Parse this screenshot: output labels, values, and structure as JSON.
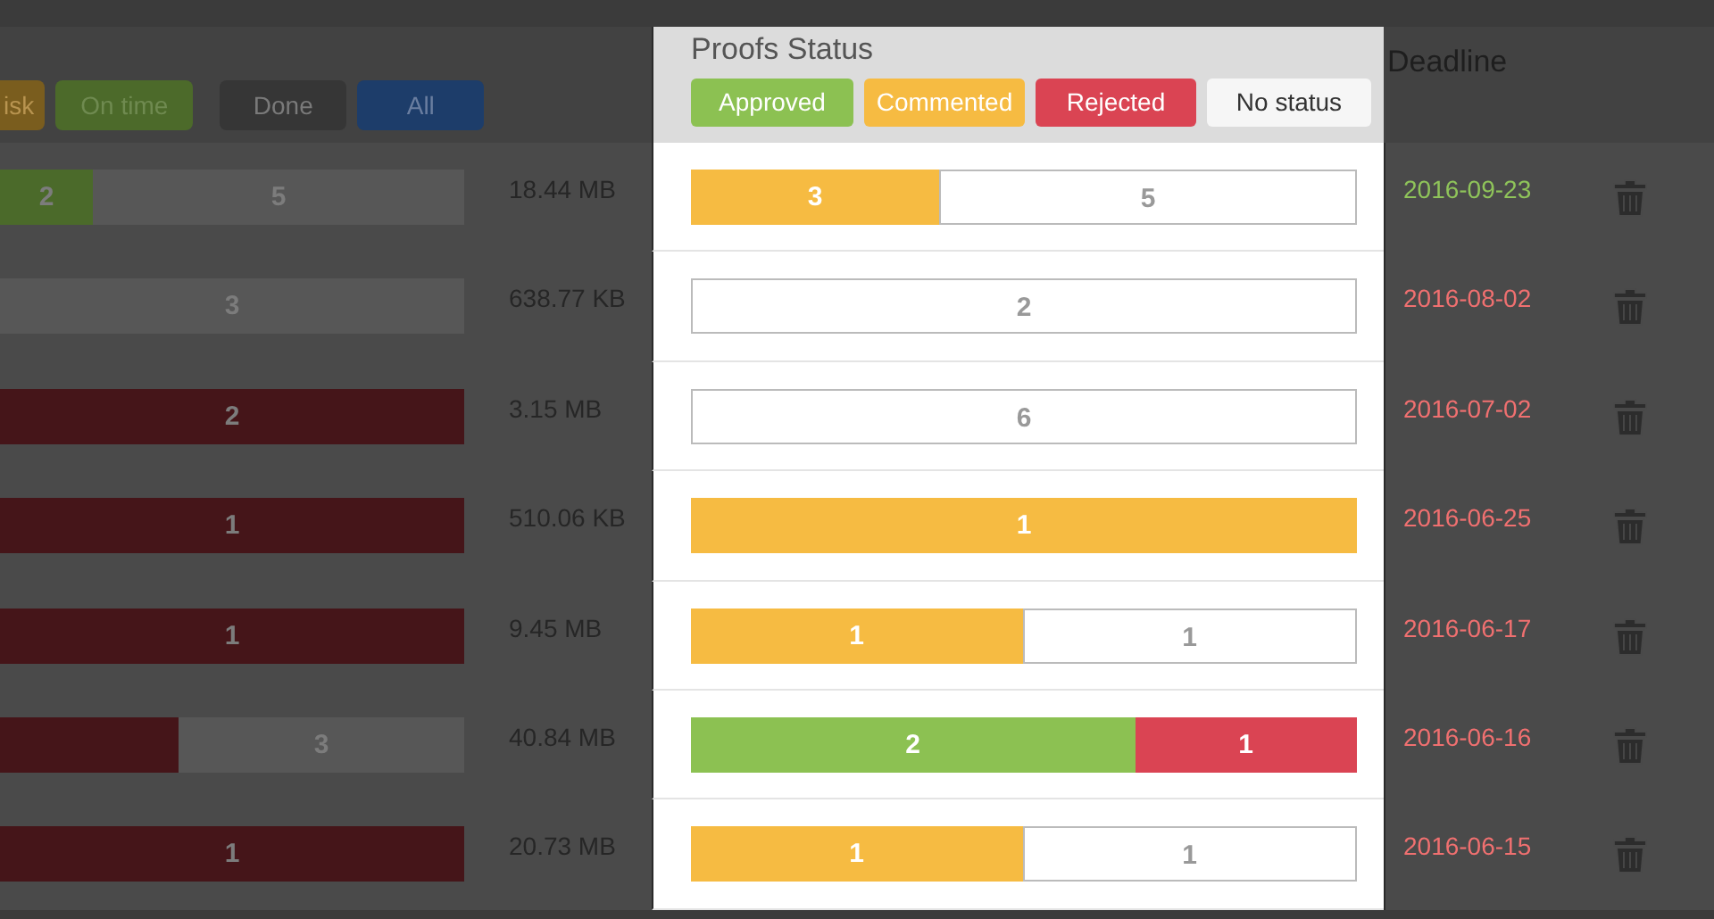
{
  "filters": [
    {
      "label": "isk",
      "kind": "at-risk"
    },
    {
      "label": "On time",
      "kind": "on-time"
    },
    {
      "label": "Done",
      "kind": "done"
    },
    {
      "label": "All",
      "kind": "all"
    }
  ],
  "deadline_header": "Deadline",
  "proofs_panel": {
    "title": "Proofs Status",
    "legend": [
      {
        "label": "Approved",
        "kind": "approved"
      },
      {
        "label": "Commented",
        "kind": "commented"
      },
      {
        "label": "Rejected",
        "kind": "rejected"
      },
      {
        "label": "No status",
        "kind": "none"
      }
    ]
  },
  "rows": [
    {
      "progress": [
        {
          "kind": "approved",
          "label": "2",
          "level": 0.2
        },
        {
          "kind": "none",
          "label": "5",
          "level": 0.8
        }
      ],
      "size": "18.44 MB",
      "proofs": [
        {
          "kind": "commented",
          "count": "3"
        },
        {
          "kind": "none",
          "count": "5"
        }
      ],
      "deadline": "2016-09-23",
      "late": false
    },
    {
      "progress": [
        {
          "kind": "none",
          "label": "3",
          "level": 1
        }
      ],
      "size": "638.77 KB",
      "proofs": [
        {
          "kind": "none",
          "count": "2"
        }
      ],
      "deadline": "2016-08-02",
      "late": true
    },
    {
      "progress": [
        {
          "kind": "rejected",
          "label": "2",
          "level": 1
        }
      ],
      "size": "3.15 MB",
      "proofs": [
        {
          "kind": "none",
          "count": "6"
        }
      ],
      "deadline": "2016-07-02",
      "late": true
    },
    {
      "progress": [
        {
          "kind": "rejected",
          "label": "1",
          "level": 1
        }
      ],
      "size": "510.06 KB",
      "proofs": [
        {
          "kind": "commented",
          "count": "1"
        }
      ],
      "deadline": "2016-06-25",
      "late": true
    },
    {
      "progress": [
        {
          "kind": "rejected",
          "label": "1",
          "level": 1
        }
      ],
      "size": "9.45 MB",
      "proofs": [
        {
          "kind": "commented",
          "count": "1"
        },
        {
          "kind": "none",
          "count": "1"
        }
      ],
      "deadline": "2016-06-17",
      "late": true
    },
    {
      "progress": [
        {
          "kind": "rejected",
          "level": 0.385
        },
        {
          "kind": "none",
          "label": "3",
          "level": 0.615
        }
      ],
      "size": "40.84 MB",
      "proofs": [
        {
          "kind": "approved",
          "count": "2"
        },
        {
          "kind": "rejected",
          "count": "1"
        }
      ],
      "deadline": "2016-06-16",
      "late": true
    },
    {
      "progress": [
        {
          "kind": "rejected",
          "label": "1",
          "level": 1
        }
      ],
      "size": "20.73 MB",
      "proofs": [
        {
          "kind": "commented",
          "count": "1"
        },
        {
          "kind": "none",
          "count": "1"
        }
      ],
      "deadline": "2016-06-15",
      "late": true
    }
  ]
}
